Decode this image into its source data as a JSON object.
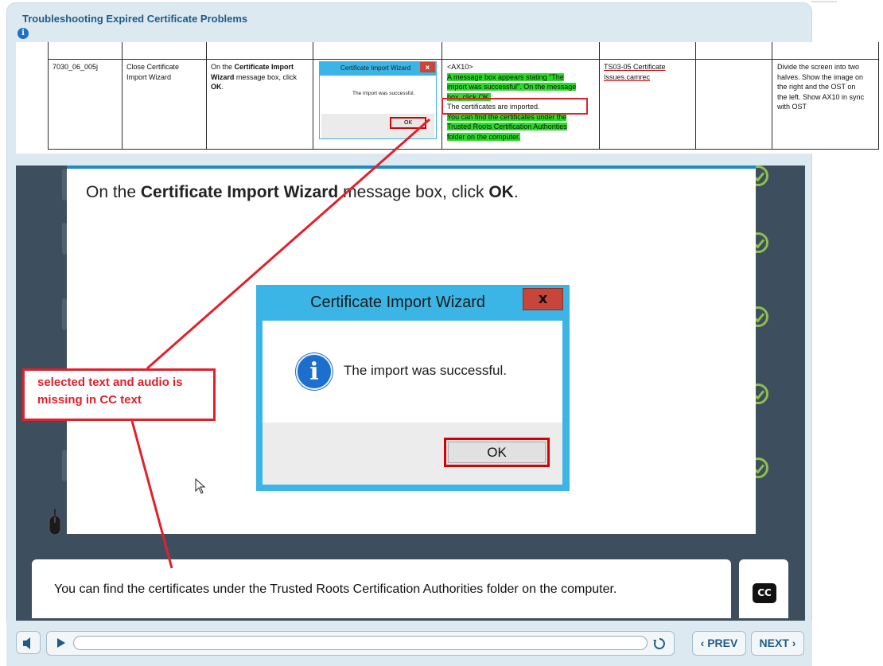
{
  "header": {
    "title": "Troubleshooting Expired Certificate Problems"
  },
  "storyboard_row": {
    "id": "7030_06_005j",
    "step_title": "Close Certificate Import Wizard",
    "instruction": {
      "prefix": "On the ",
      "bold1": "Certificate Import Wizard",
      "middle": " message box, click ",
      "bold2": "OK",
      "suffix": "."
    },
    "thumbnail": {
      "title": "Certificate Import Wizard",
      "close": "x",
      "message": "The import was successful.",
      "ok": "OK"
    },
    "audio": {
      "tag": "<AX10>",
      "line1": "A message box appears stating \"The",
      "line2": "import was successful\". On the message",
      "line3": "box, click OK.",
      "line4": "The certificates are imported.",
      "line5": "You can find the certificates under the",
      "line6": "Trusted Roots Certification Authorities",
      "line7": "folder on the computer."
    },
    "media": "TS03-05 Certificate Issues.camrec",
    "notes": {
      "line1": "Divide the screen into two",
      "line2": "halves. Show the image on",
      "line3": "the right and the OST on",
      "line4": "the left. Show AX10 in sync",
      "line5": "with OST"
    }
  },
  "slide": {
    "instruction_prefix": "On the ",
    "instruction_bold1": "Certificate Import Wizard",
    "instruction_middle": " message box, click ",
    "instruction_bold2": "OK",
    "instruction_suffix": "."
  },
  "dialog": {
    "title": "Certificate Import Wizard",
    "close": "x",
    "info_glyph": "i",
    "message": "The import was successful.",
    "ok": "OK"
  },
  "annotation": {
    "text": "selected text and audio is missing in CC text"
  },
  "caption": {
    "text": "You can find the certificates under the Trusted Roots Certification Authorities folder on the computer.",
    "cc_label": "CC"
  },
  "player": {
    "prev": "‹ PREV",
    "next": "NEXT ›"
  },
  "colors": {
    "annotation_red": "#e3202a",
    "dialog_blue": "#3bb5e5",
    "frame_blue": "#dce9f1",
    "highlight_green": "#2bdc27",
    "slide_dark": "#3d4f5f"
  },
  "icons": [
    "information-icon",
    "close-icon",
    "cursor-icon",
    "mouse-icon",
    "volume-icon",
    "play-icon",
    "replay-icon",
    "cc-icon",
    "check-icon"
  ]
}
